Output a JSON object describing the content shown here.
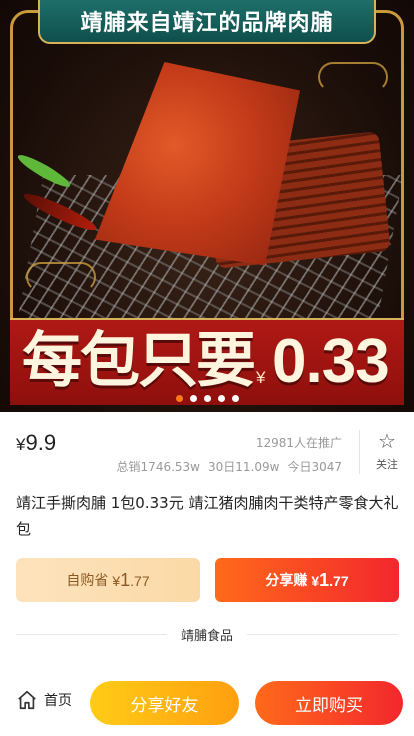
{
  "hero": {
    "title": "靖脯来自靖江的品牌肉脯",
    "promo_text": "每包只要",
    "promo_currency": "¥",
    "promo_price": "0.33",
    "slides": 5,
    "active_slide": 0
  },
  "product": {
    "currency": "¥",
    "price": "9.9",
    "promoters": "12981人在推广",
    "total_sales": "总销1746.53w",
    "sales_30d": "30日11.09w",
    "sales_today": "今日3047",
    "follow_label": "关注",
    "title": "靖江手撕肉脯 1包0.33元 靖江猪肉脯肉干类特产零食大礼包"
  },
  "earn": {
    "self_label": "自购省",
    "self_currency": "¥",
    "self_int": "1",
    "self_dec": ".77",
    "share_label": "分享赚",
    "share_currency": "¥",
    "share_int": "1",
    "share_dec": ".77"
  },
  "shop": {
    "name": "靖脯食品"
  },
  "bottom_bar": {
    "home_label": "首页",
    "share_label": "分享好友",
    "buy_label": "立即购买"
  },
  "colors": {
    "accent_orange": "#ff6a1a",
    "accent_red": "#f3272d",
    "accent_yellow": "#ffcc17",
    "banner_red": "#b01915"
  }
}
